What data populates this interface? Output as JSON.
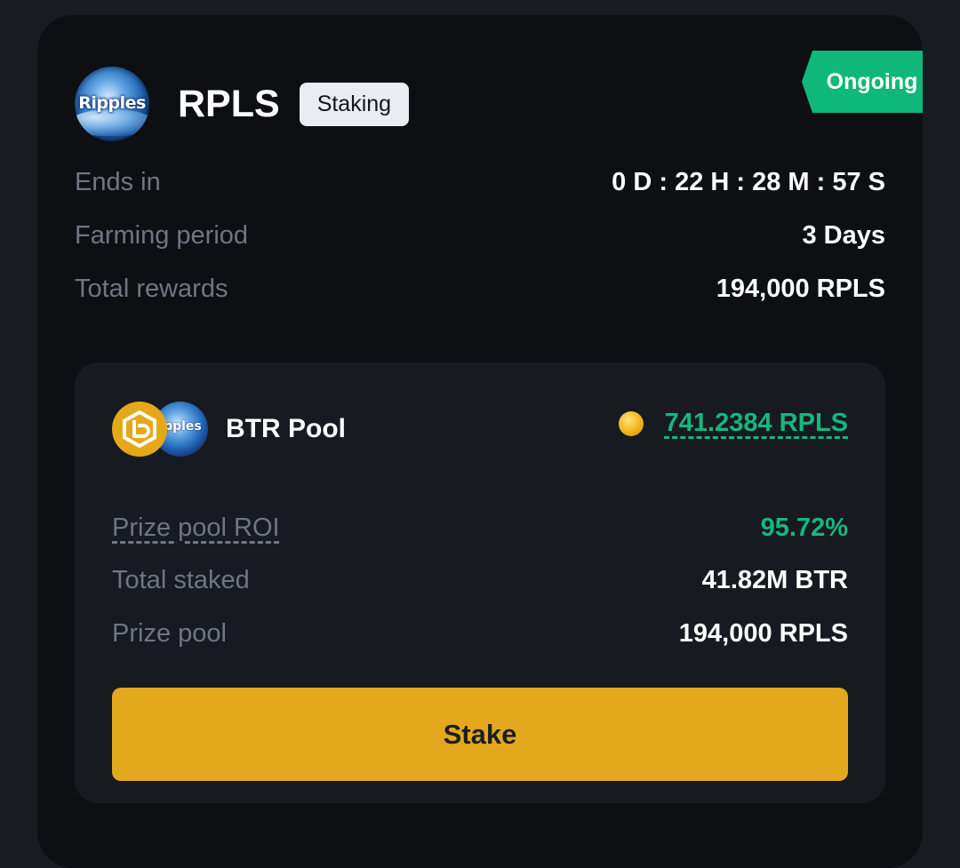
{
  "token": {
    "logo_text": "Ripples",
    "name": "RPLS",
    "tag": "Staking"
  },
  "status": "Ongoing",
  "info": [
    {
      "label": "Ends in",
      "value": "0 D : 22 H : 28 M : 57 S"
    },
    {
      "label": "Farming period",
      "value": "3 Days"
    },
    {
      "label": "Total rewards",
      "value": "194,000 RPLS"
    }
  ],
  "pool": {
    "name": "BTR Pool",
    "logo_small_text": "ipples",
    "reward": "741.2384 RPLS",
    "rows": [
      {
        "label": "Prize pool ROI",
        "value": "95.72%"
      },
      {
        "label": "Total staked",
        "value": "41.82M BTR"
      },
      {
        "label": "Prize pool",
        "value": "194,000 RPLS"
      }
    ],
    "button": "Stake"
  },
  "colors": {
    "accent_green": "#14b87d",
    "stake_yellow": "#e4a81e",
    "card_bg": "#0e0f12",
    "pool_bg": "#171a20"
  }
}
